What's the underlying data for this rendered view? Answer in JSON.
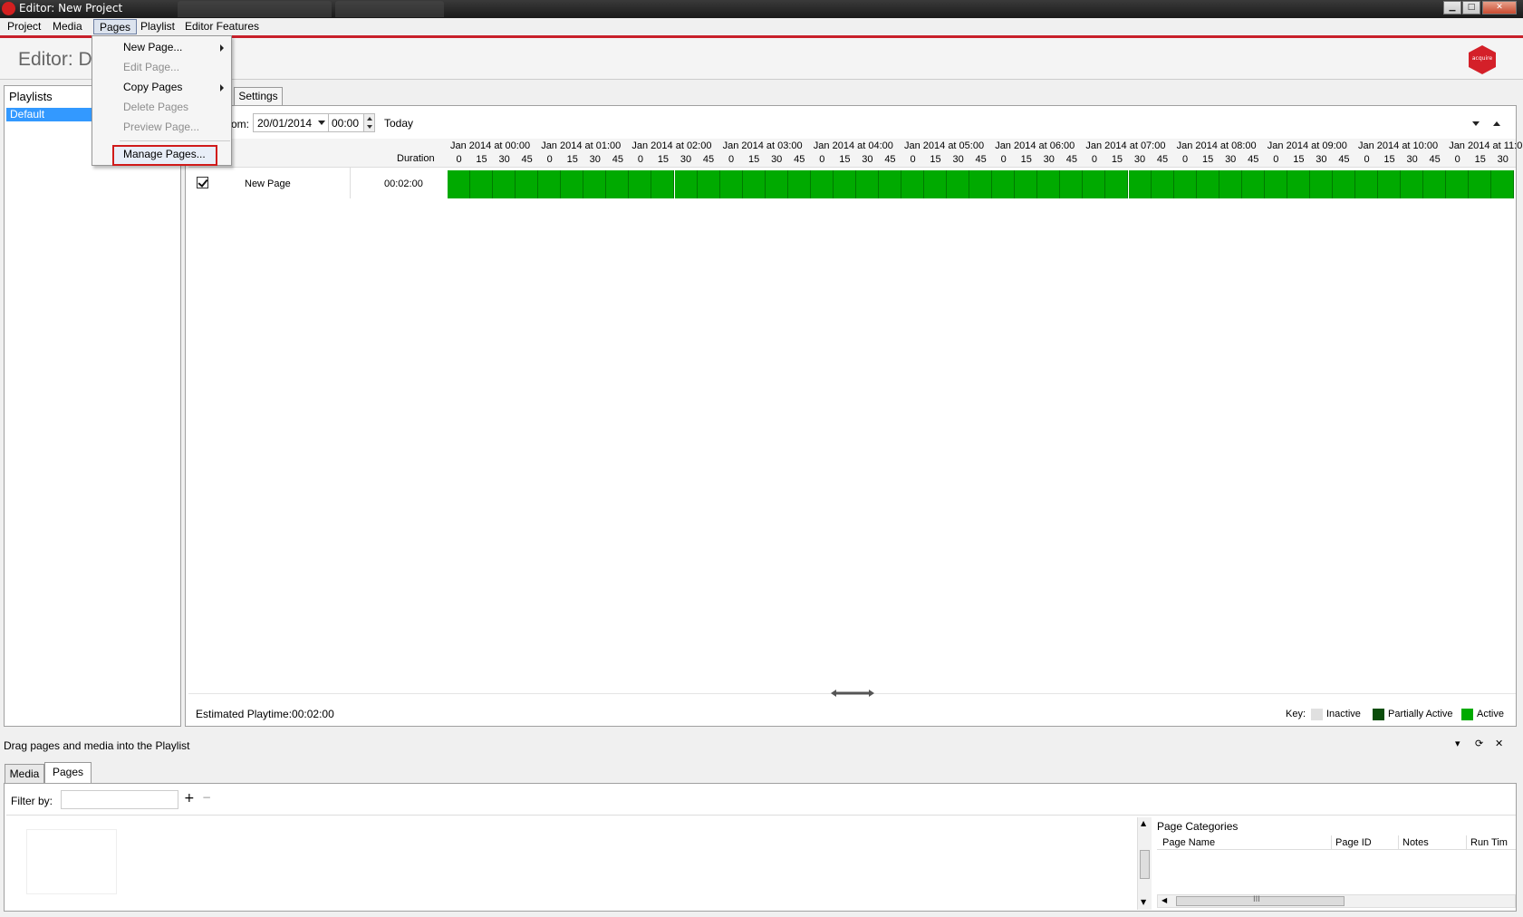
{
  "window": {
    "title": "Editor: New Project",
    "controls": {
      "minimize": "▁",
      "maximize": "□",
      "close": "✕"
    }
  },
  "menubar": {
    "items": [
      "Project",
      "Media",
      "Pages",
      "Playlist",
      "Editor Features"
    ]
  },
  "pages_menu": {
    "items": [
      {
        "label": "New Page...",
        "enabled": true,
        "submenu": true
      },
      {
        "label": "Edit Page...",
        "enabled": false,
        "submenu": false
      },
      {
        "label": "Copy Pages",
        "enabled": true,
        "submenu": true
      },
      {
        "label": "Delete Pages",
        "enabled": false,
        "submenu": false
      },
      {
        "label": "Preview Page...",
        "enabled": false,
        "submenu": false
      },
      {
        "label": "Manage Pages...",
        "enabled": true,
        "submenu": false,
        "highlighted": true
      }
    ]
  },
  "header": {
    "title": "Editor: D",
    "brand_logo_text": "acquire"
  },
  "playlists": {
    "header": "Playlists",
    "items": [
      {
        "label": "Default",
        "selected": true
      }
    ]
  },
  "schedule": {
    "tab_label": "Settings",
    "from_label": "rom:",
    "date_value": "20/01/2014",
    "time_value": "00:00",
    "today_label": "Today",
    "duration_header": "Duration",
    "hours": [
      "Jan 2014 at 00:00",
      "Jan 2014 at 01:00",
      "Jan 2014 at 02:00",
      "Jan 2014 at 03:00",
      "Jan 2014 at 04:00",
      "Jan 2014 at 05:00",
      "Jan 2014 at 06:00",
      "Jan 2014 at 07:00",
      "Jan 2014 at 08:00",
      "Jan 2014 at 09:00",
      "Jan 2014 at 10:00",
      "Jan 2014 at 11:0"
    ],
    "quarters": [
      "0",
      "15",
      "30",
      "45"
    ],
    "rows": [
      {
        "checked": true,
        "name": "New Page",
        "duration": "00:02:00",
        "status": "Active"
      }
    ],
    "estimated_playtime": "Estimated Playtime:00:02:00",
    "legend": {
      "label": "Key:",
      "items": [
        {
          "label": "Inactive",
          "color": "#e0e0e0"
        },
        {
          "label": "Partially Active",
          "color": "#0b4d0b"
        },
        {
          "label": "Active",
          "color": "#00aa00"
        }
      ]
    }
  },
  "lower": {
    "hint": "Drag pages and media into the Playlist",
    "tabs": [
      "Media",
      "Pages"
    ],
    "active_tab": "Pages",
    "filter_label": "Filter by:",
    "filter_value": "",
    "add_symbol": "+",
    "remove_symbol": "−",
    "categories_title": "Page Categories",
    "columns": [
      "Page Name",
      "Page ID",
      "Notes",
      "Run Tim"
    ],
    "controls": {
      "dropdown": "▾",
      "pin": "⟳",
      "close": "✕"
    },
    "scroll_grip": "III"
  },
  "colors": {
    "accent_red": "#c8202a",
    "active_green": "#00aa00",
    "selection_blue": "#3399ff"
  }
}
